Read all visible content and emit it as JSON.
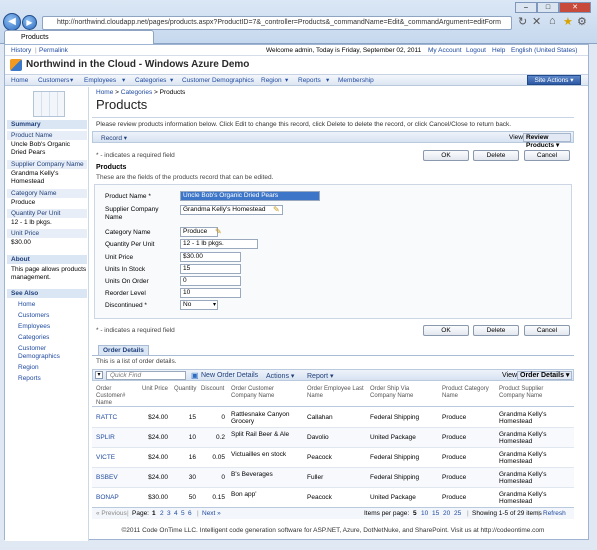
{
  "browser": {
    "address": "http://northwind.cloudapp.net/pages/products.aspx?ProductID=7&_controller=Products&_commandName=Edit&_commandArgument=editForm",
    "tab_title": "Products"
  },
  "topbar": {
    "left_links": [
      "History",
      "Permalink"
    ],
    "welcome": "Welcome admin, Today is Friday, September 02, 2011",
    "right_links": [
      "My Account",
      "Logout",
      "Help",
      "English (United States)"
    ]
  },
  "header": {
    "title": "Northwind in the Cloud - Windows Azure Demo"
  },
  "menu": {
    "items": [
      "Home",
      "Customers",
      "Employees",
      "Categories",
      "Customer Demographics",
      "Region",
      "Reports",
      "Membership"
    ],
    "site_actions": "Site Actions"
  },
  "sidebar": {
    "summary": "Summary",
    "fields": [
      {
        "label": "Product Name",
        "value": "Uncle Bob's Organic Dried Pears"
      },
      {
        "label": "Supplier Company Name",
        "value": "Grandma Kelly's Homestead"
      },
      {
        "label": "Category Name",
        "value": "Produce"
      },
      {
        "label": "Quantity Per Unit",
        "value": "12 - 1 lb pkgs."
      },
      {
        "label": "Unit Price",
        "value": "$30.00"
      }
    ],
    "about_title": "About",
    "about_text": "This page allows products management.",
    "see_also_title": "See Also",
    "see_also": [
      "Home",
      "Customers",
      "Employees",
      "Categories",
      "Customer Demographics",
      "Region",
      "Reports"
    ]
  },
  "main": {
    "breadcrumb": [
      "Home",
      "Categories",
      "Products"
    ],
    "title": "Products",
    "instructions": "Please review products information below. Click Edit to change this record, click Delete to delete the record, or click Cancel/Close to return back.",
    "record_menu": "Record",
    "view_label": "View:",
    "view_value": "Review Products",
    "required_note": "* - indicates a required field",
    "buttons": {
      "ok": "OK",
      "delete": "Delete",
      "cancel": "Cancel"
    },
    "section_title": "Products",
    "section_sub": "These are the fields of the products record that can be edited.",
    "form": [
      {
        "label": "Product Name *",
        "value": "Uncle Bob's Organic Dried Pears"
      },
      {
        "label": "Supplier Company Name",
        "value": "Grandma Kelly's Homestead"
      },
      {
        "label": "Category Name",
        "value": "Produce"
      },
      {
        "label": "Quantity Per Unit",
        "value": "12 - 1 lb pkgs."
      },
      {
        "label": "Unit Price",
        "value": "$30.00"
      },
      {
        "label": "Units In Stock",
        "value": "15"
      },
      {
        "label": "Units On Order",
        "value": "0"
      },
      {
        "label": "Reorder Level",
        "value": "10"
      },
      {
        "label": "Discontinued *",
        "value": "No"
      }
    ]
  },
  "details": {
    "tab": "Order Details",
    "intro": "This is a list of order details.",
    "quick_find": "Quick Find",
    "new_label": "New Order Details",
    "actions": "Actions",
    "report": "Report",
    "view_label": "View:",
    "view_value": "Order Details",
    "columns": [
      "Order Customer# Name",
      "Unit Price",
      "Quantity",
      "Discount",
      "Order Customer Company Name",
      "Order Employee Last Name",
      "Order Ship Via Company Name",
      "Product Category Name",
      "Product Supplier Company Name"
    ],
    "rows": [
      [
        "RATTC",
        "$24.00",
        "15",
        "0",
        "Rattlesnake Canyon Grocery",
        "Callahan",
        "Federal Shipping",
        "Produce",
        "Grandma Kelly's Homestead"
      ],
      [
        "SPLIR",
        "$24.00",
        "10",
        "0.2",
        "Split Rail Beer & Ale",
        "Davolio",
        "United Package",
        "Produce",
        "Grandma Kelly's Homestead"
      ],
      [
        "VICTE",
        "$24.00",
        "16",
        "0.05",
        "Victuailles en stock",
        "Peacock",
        "Federal Shipping",
        "Produce",
        "Grandma Kelly's Homestead"
      ],
      [
        "BSBEV",
        "$24.00",
        "30",
        "0",
        "B's Beverages",
        "Fuller",
        "Federal Shipping",
        "Produce",
        "Grandma Kelly's Homestead"
      ],
      [
        "BONAP",
        "$30.00",
        "50",
        "0.15",
        "Bon app'",
        "Peacock",
        "United Package",
        "Produce",
        "Grandma Kelly's Homestead"
      ]
    ],
    "pager": {
      "prev": "« Previous",
      "page_label": "Page:",
      "pages": [
        "1",
        "2",
        "3",
        "4",
        "5",
        "6"
      ],
      "next": "Next »",
      "per_page": "Items per page:",
      "sizes": [
        "5",
        "10",
        "15",
        "20",
        "25"
      ],
      "showing": "Showing 1-5 of 29 items",
      "refresh": "Refresh"
    }
  },
  "footer": {
    "text": "©2011 Code OnTime LLC. Intelligent code generation software for ASP.NET, Azure, DotNetNuke, and SharePoint. Visit us at http://codeontime.com"
  }
}
